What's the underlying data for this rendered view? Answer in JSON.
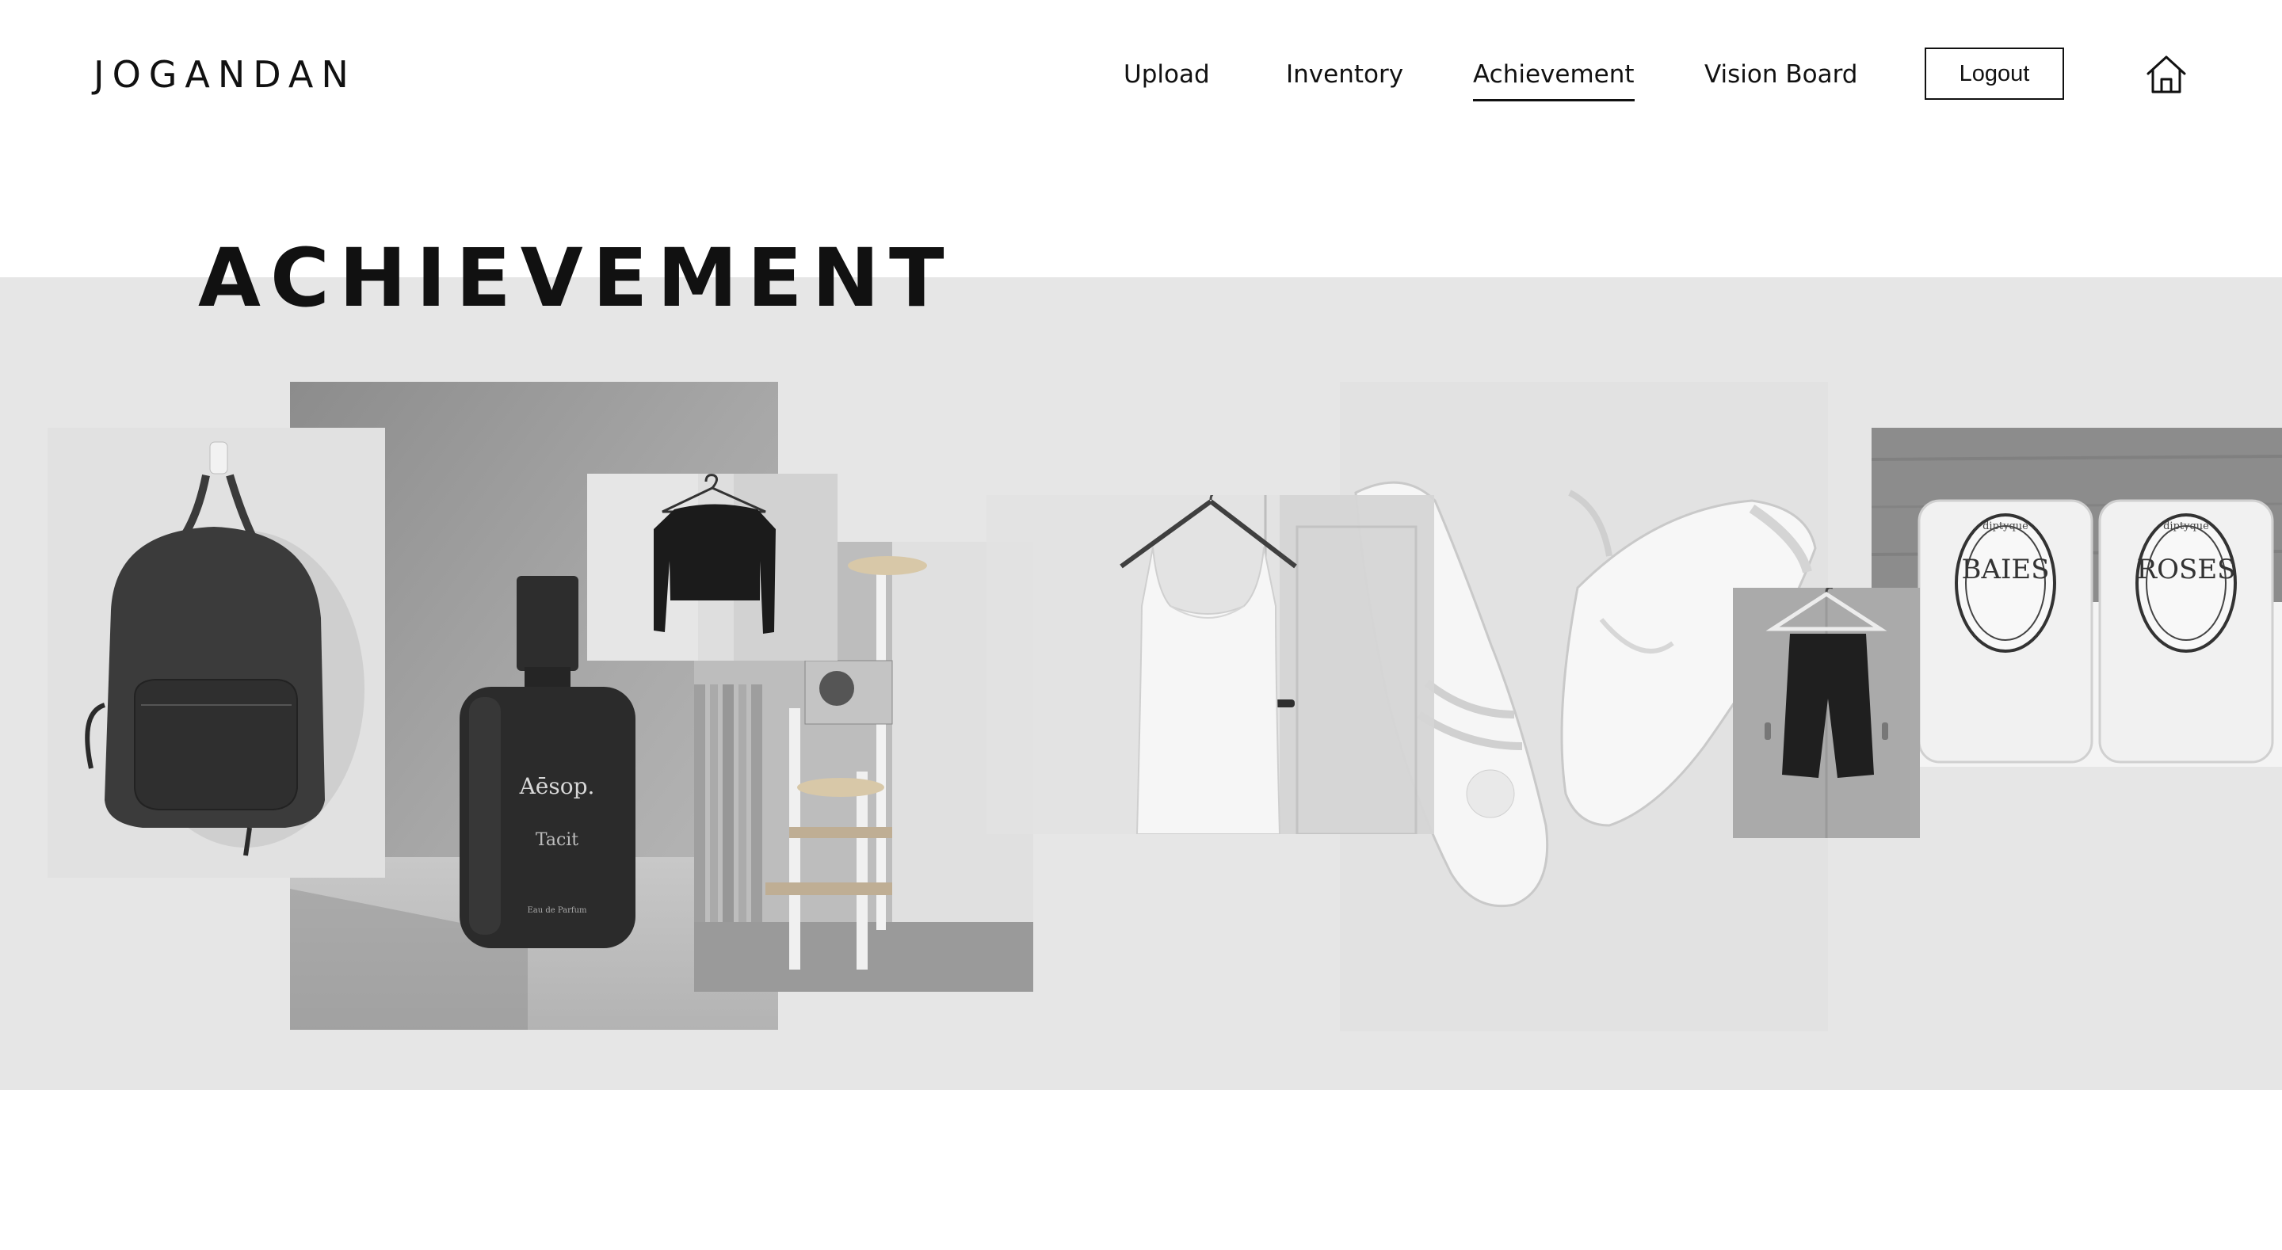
{
  "header": {
    "logo": "JOGANDAN",
    "nav": [
      {
        "label": "Upload",
        "active": false
      },
      {
        "label": "Inventory",
        "active": false
      },
      {
        "label": "Achievement",
        "active": true
      },
      {
        "label": "Vision Board",
        "active": false
      }
    ],
    "logout_label": "Logout",
    "home_icon": "home-icon"
  },
  "main": {
    "title": "ACHIEVEMENT",
    "items": [
      {
        "name": "backpack"
      },
      {
        "name": "perfume-bottle",
        "brand_text": "Aēsop.",
        "product_text": "Tacit",
        "small_text": "Eau de Parfum"
      },
      {
        "name": "black-crop-top"
      },
      {
        "name": "cat-tower"
      },
      {
        "name": "white-dress"
      },
      {
        "name": "white-sneakers"
      },
      {
        "name": "black-shorts"
      },
      {
        "name": "candles",
        "label_left": "BAIES",
        "label_right": "ROSES",
        "brand_text": "diptyque"
      }
    ]
  },
  "colors": {
    "band": "#e6e6e6",
    "text": "#111111"
  }
}
